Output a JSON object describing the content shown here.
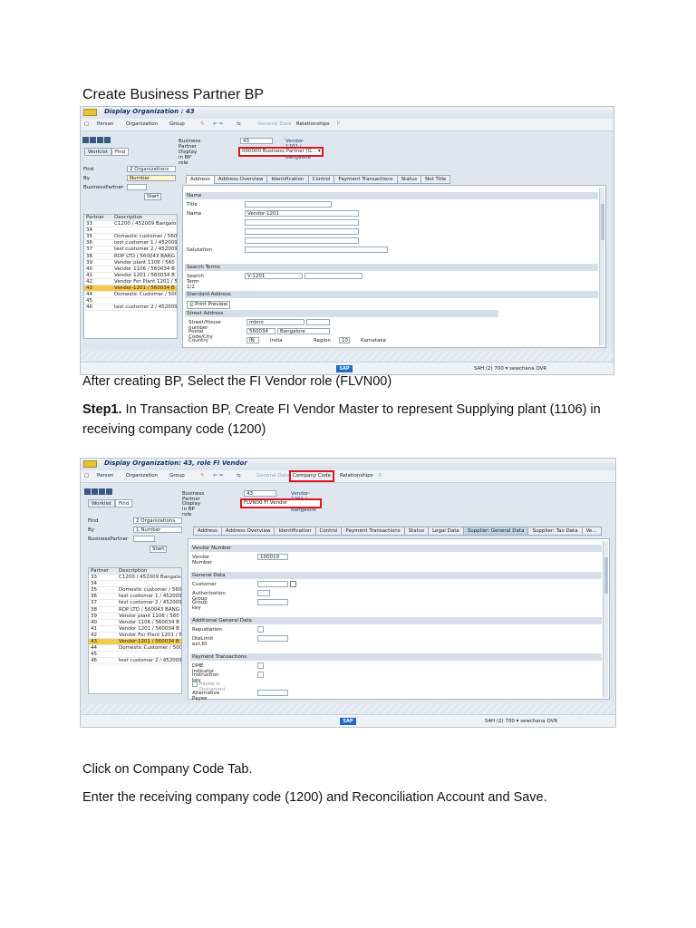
{
  "doc": {
    "title": "Create Business Partner BP",
    "after1": "After creating BP, Select the FI Vendor role (FLVN00)",
    "step_label": "Step1.",
    "step_text": " In Transaction BP, Create FI Vendor Master to represent Supplying plant (1106) in receiving company code (1200)",
    "click_text": "Click on Company Code Tab.",
    "enter_text": "Enter the receiving company code (1200) and Reconciliation Account and Save."
  },
  "shot1": {
    "window_title": "Display Organization : 43",
    "toolbar": [
      "Person",
      "Organization",
      "Group",
      "General Data",
      "Relationships"
    ],
    "nav_tabs": [
      "Worklist",
      "Find"
    ],
    "bp_label": "Business Partner",
    "bp_value": "43",
    "bp_desc": "Vendor-1201 / 560034 Bangalore",
    "role_label": "Display in BP role",
    "role_value": "000000 Business Partner (G... ▾",
    "find_label": "Find",
    "find_value": "2 Organizations",
    "by_label": "By",
    "by_value": "Number",
    "bp_field_label": "BusinessPartner",
    "start_btn": "Start",
    "list_header": [
      "Partner",
      "Description"
    ],
    "list_rows": [
      [
        "33",
        "C1200 / 452009 Bangalor"
      ],
      [
        "34",
        ""
      ],
      [
        "35",
        "Domestic customer / 560"
      ],
      [
        "36",
        "test customer 1 / 452009"
      ],
      [
        "37",
        "test customer 2 / 452009"
      ],
      [
        "38",
        "RDP LTD / 560043 BANG"
      ],
      [
        "39",
        "Vendor plant 1106 / 560"
      ],
      [
        "40",
        "Vendor 1106 / 560034 B"
      ],
      [
        "41",
        "Vendor 1201 / 560034 B"
      ],
      [
        "42",
        "Vendor For Plant 1201 / 5"
      ],
      [
        "43",
        "Vendor-1201 / 560034 B"
      ],
      [
        "44",
        "Domestic Customer / 500"
      ],
      [
        "45",
        ""
      ],
      [
        "46",
        "test customer 2 / 452009"
      ]
    ],
    "tabs": [
      "Address",
      "Address Overview",
      "Identification",
      "Control",
      "Payment Transactions",
      "Status",
      "Not Title"
    ],
    "sec_name": "Name",
    "title_label": "Title",
    "name_label": "Name",
    "name_value": "Vendor-1201",
    "salutation_label": "Salutation",
    "sec_search": "Search Terms",
    "search_label": "Search Term 1/2",
    "search_value": "V-1201",
    "sec_std": "Standard Address",
    "print_preview": "Print Preview",
    "street_hdr": "Street Address",
    "street_label": "Street/House number",
    "street_value": "mbno",
    "postal_label": "Postal Code/City",
    "postal_value": "560034",
    "city_value": "Bangalore",
    "country_label": "Country",
    "country_code": "IN",
    "country_name": "India",
    "region_label": "Region",
    "region_code": "10",
    "region_name": "Karnataka",
    "status_right": "S4H (2) 700 ▾  sewchana  OVR",
    "sap_logo": "SAP"
  },
  "shot2": {
    "window_title": "Display Organization: 43, role FI Vendor",
    "toolbar": [
      "Person",
      "Organization",
      "Group",
      "General Data",
      "Company Code",
      "Relationships"
    ],
    "nav_tabs": [
      "Worklist",
      "Find"
    ],
    "bp_label": "Business Partner",
    "bp_value": "43",
    "bp_desc": "Vendor-1201 / 560034 Bangalore",
    "role_label": "Display in BP role",
    "role_value": "FLVN00 FI Vendor",
    "find_label": "Find",
    "find_value": "2 Organizations",
    "by_label": "By",
    "by_value": "1 Number",
    "bp_field_label": "BusinessPartner",
    "start_btn": "Start",
    "list_header": [
      "Partner",
      "Description"
    ],
    "list_rows": [
      [
        "33",
        "C1200 / 452009 Bangalor"
      ],
      [
        "34",
        ""
      ],
      [
        "35",
        "Domestic customer / 560"
      ],
      [
        "36",
        "test customer 1 / 452009"
      ],
      [
        "37",
        "test customer 2 / 452009"
      ],
      [
        "38",
        "RDP LTD / 560043 BANG"
      ],
      [
        "39",
        "Vendor plant 1106 / 560"
      ],
      [
        "40",
        "Vendor 1106 / 560034 B"
      ],
      [
        "41",
        "Vendor 1201 / 560034 B"
      ],
      [
        "42",
        "Vendor For Plant 1201 / 5"
      ],
      [
        "43",
        "Vendor-1201 / 560034 B"
      ],
      [
        "44",
        "Domestic Customer / 500"
      ],
      [
        "45",
        ""
      ],
      [
        "46",
        "test customer 2 / 452009"
      ]
    ],
    "tabs": [
      "Address",
      "Address Overview",
      "Identification",
      "Control",
      "Payment Transactions",
      "Status",
      "Legal Data",
      "Supplier: General Data",
      "Supplier: Tax Data",
      "Ve..."
    ],
    "sec_vendor": "Vendor Number",
    "vendor_label": "Vendor Number",
    "vendor_value": "100019",
    "sec_general": "General Data",
    "customer_label": "Customer",
    "auth_label": "Authorization Group",
    "group_label": "Group key",
    "sec_additional": "Additional General Data",
    "repudiation_label": "Repudiation",
    "dtelimit_label": "DteLimit ext.ID",
    "sec_payment": "Payment Transactions",
    "dme_label": "DME indicator",
    "instruction_label": "Instruction key",
    "payee_doc": "Payee in Document",
    "alt_payee_label": "Alternative Payee",
    "status_right": "S4H (2) 700 ▾  sewchana  OVR",
    "sap_logo": "SAP"
  }
}
